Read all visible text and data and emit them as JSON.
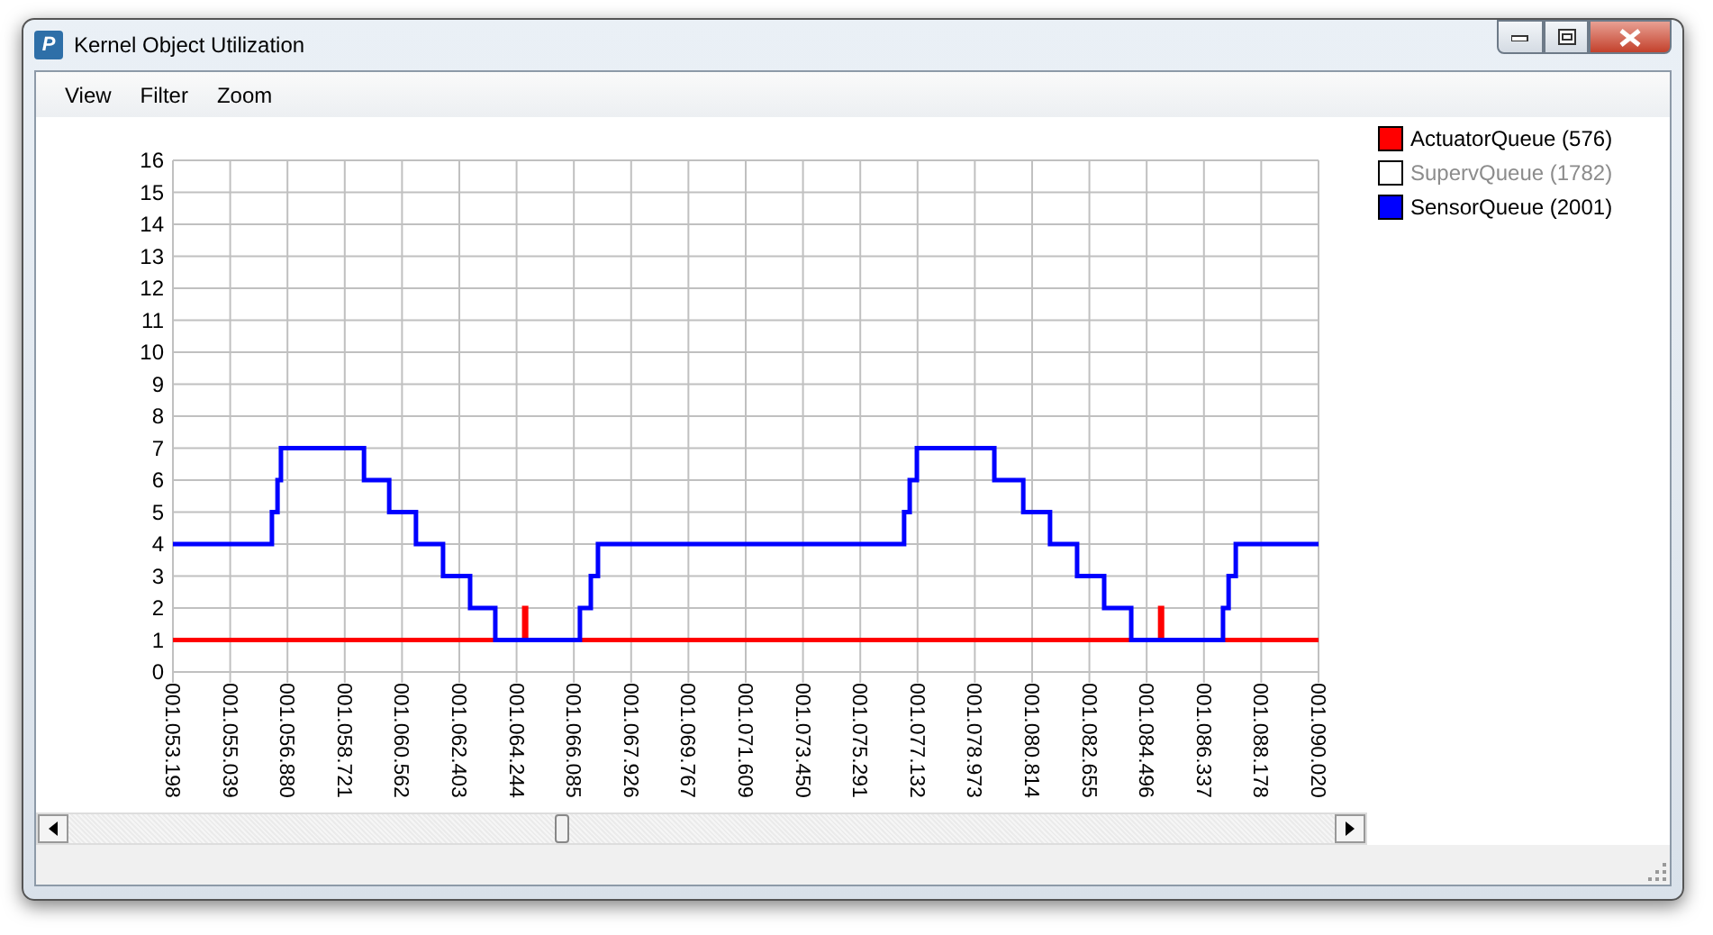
{
  "window": {
    "title": "Kernel Object Utilization",
    "icon_text": "P"
  },
  "menu": [
    "View",
    "Filter",
    "Zoom"
  ],
  "legend": [
    {
      "label": "ActuatorQueue (576)",
      "color": "#ff0000",
      "enabled": true
    },
    {
      "label": "SupervQueue (1782)",
      "enabled": false
    },
    {
      "label": "SensorQueue (2001)",
      "color": "#0000ff",
      "enabled": true
    }
  ],
  "chart_data": {
    "type": "line",
    "x": [
      1053198,
      1056380,
      1056380,
      1056560,
      1056560,
      1056670,
      1056670,
      1059340,
      1059340,
      1060150,
      1060150,
      1061010,
      1061010,
      1061880,
      1061880,
      1062750,
      1062750,
      1063560,
      1063560,
      1064490,
      1064490,
      1064550,
      1064550,
      1066280,
      1066280,
      1066630,
      1066630,
      1066860,
      1066860,
      1076700,
      1076700,
      1076880,
      1076880,
      1077110,
      1077110,
      1079600,
      1079600,
      1080530,
      1080530,
      1081390,
      1081390,
      1082260,
      1082260,
      1083130,
      1083130,
      1084000,
      1084000,
      1084930,
      1084930,
      1084990,
      1084990,
      1086950,
      1086950,
      1087130,
      1087130,
      1087360,
      1087360,
      1090020
    ],
    "series": [
      {
        "color": "#ff0000",
        "values": [
          1,
          1,
          1,
          1,
          1,
          1,
          1,
          1,
          1,
          1,
          1,
          1,
          1,
          1,
          1,
          1,
          1,
          1,
          1,
          1,
          2,
          2,
          1,
          1,
          1,
          1,
          1,
          1,
          1,
          1,
          1,
          1,
          1,
          1,
          1,
          1,
          1,
          1,
          1,
          1,
          1,
          1,
          1,
          1,
          1,
          1,
          1,
          1,
          2,
          2,
          1,
          1,
          1,
          1,
          1,
          1,
          1,
          1
        ]
      },
      {
        "color": "#0000ff",
        "values": [
          4,
          4,
          5,
          5,
          6,
          6,
          7,
          7,
          6,
          6,
          5,
          5,
          4,
          4,
          3,
          3,
          2,
          2,
          1,
          1,
          1,
          1,
          1,
          1,
          2,
          2,
          3,
          3,
          4,
          4,
          5,
          5,
          6,
          6,
          7,
          7,
          6,
          6,
          5,
          5,
          4,
          4,
          3,
          3,
          2,
          2,
          1,
          1,
          1,
          1,
          1,
          1,
          2,
          2,
          3,
          3,
          4,
          4
        ]
      }
    ],
    "xlim": [
      1053198,
      1090020
    ],
    "ylim": [
      0,
      16
    ],
    "grid": true,
    "yticks": [
      0,
      1,
      2,
      3,
      4,
      5,
      6,
      7,
      8,
      9,
      10,
      11,
      12,
      13,
      14,
      15,
      16
    ],
    "xticks": [
      {
        "value": 1053198,
        "label": "001.053.198"
      },
      {
        "value": 1055039,
        "label": "001.055.039"
      },
      {
        "value": 1056880,
        "label": "001.056.880"
      },
      {
        "value": 1058721,
        "label": "001.058.721"
      },
      {
        "value": 1060562,
        "label": "001.060.562"
      },
      {
        "value": 1062403,
        "label": "001.062.403"
      },
      {
        "value": 1064244,
        "label": "001.064.244"
      },
      {
        "value": 1066085,
        "label": "001.066.085"
      },
      {
        "value": 1067926,
        "label": "001.067.926"
      },
      {
        "value": 1069767,
        "label": "001.069.767"
      },
      {
        "value": 1071609,
        "label": "001.071.609"
      },
      {
        "value": 1073450,
        "label": "001.073.450"
      },
      {
        "value": 1075291,
        "label": "001.075.291"
      },
      {
        "value": 1077132,
        "label": "001.077.132"
      },
      {
        "value": 1078973,
        "label": "001.078.973"
      },
      {
        "value": 1080814,
        "label": "001.080.814"
      },
      {
        "value": 1082655,
        "label": "001.082.655"
      },
      {
        "value": 1084496,
        "label": "001.084.496"
      },
      {
        "value": 1086337,
        "label": "001.086.337"
      },
      {
        "value": 1088178,
        "label": "001.088.178"
      },
      {
        "value": 1090020,
        "label": "001.090.020"
      }
    ]
  },
  "scrollbar": {
    "level": 0.39
  }
}
